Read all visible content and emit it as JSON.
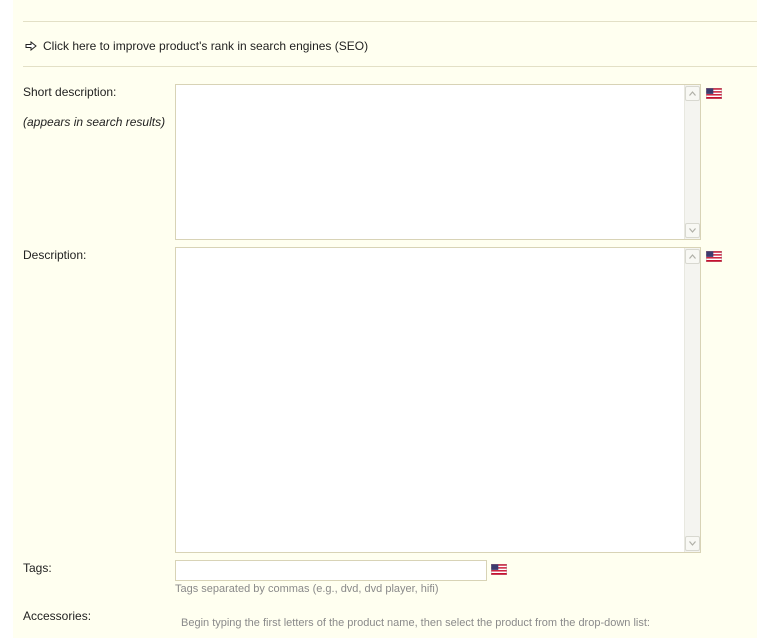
{
  "seo": {
    "link_label": "Click here to improve product's rank in search engines (SEO)"
  },
  "short_description": {
    "label": "Short description:",
    "sublabel": "(appears in search results)",
    "value": "",
    "lang_flag": "us-flag-icon"
  },
  "description": {
    "label": "Description:",
    "value": "",
    "lang_flag": "us-flag-icon"
  },
  "tags": {
    "label": "Tags:",
    "value": "",
    "hint": "Tags separated by commas (e.g., dvd, dvd player, hifi)",
    "lang_flag": "us-flag-icon"
  },
  "accessories": {
    "label": "Accessories:",
    "hint": "Begin typing the first letters of the product name, then select the product from the drop-down list:"
  },
  "colors": {
    "panel_bg": "#fffff0",
    "border": "#d8d3b6",
    "divider": "#e3e0c6"
  }
}
